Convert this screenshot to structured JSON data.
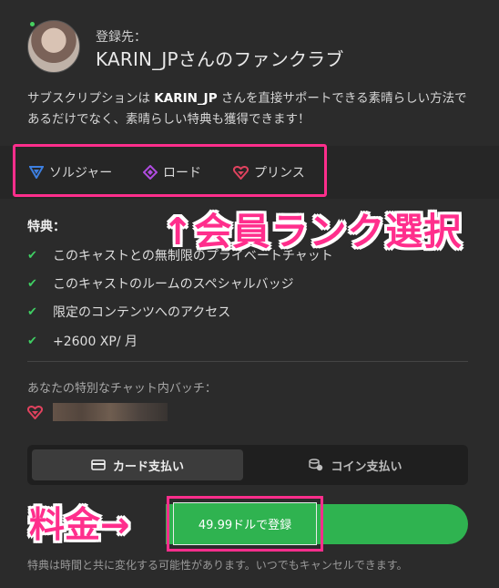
{
  "header": {
    "register_label": "登録先：",
    "club_name": "KARIN_JPさんのファンクラブ"
  },
  "description": {
    "part1": "サブスクリプションは ",
    "name": "KARIN_JP",
    "part2": " さんを直接サポートできる素晴らしい方法であるだけでなく、素晴らしい特典も獲得できます！"
  },
  "tabs": [
    {
      "label": "ソルジャー",
      "icon": "soldier-shield-icon",
      "color": "#3d7fe0"
    },
    {
      "label": "ロード",
      "icon": "lord-diamond-icon",
      "color": "#b04be0"
    },
    {
      "label": "プリンス",
      "icon": "prince-heart-icon",
      "color": "#e0425e",
      "selected": true
    }
  ],
  "annotations": {
    "rank": "↑会員ランク選択",
    "price": "料金→"
  },
  "benefits": {
    "title": "特典：",
    "items": [
      "このキャストとの無制限のプライベートチャット",
      "このキャストのルームのスペシャルバッジ",
      "限定のコンテンツへのアクセス",
      "+2600 XP/ 月"
    ]
  },
  "badge": {
    "label": "あなたの特別なチャット内バッチ："
  },
  "payment": {
    "card_label": "カード支払い",
    "coin_label": "コイン支払い",
    "selected": "card"
  },
  "submit": {
    "label": "49.99ドルで登録"
  },
  "note": "特典は時間と共に変化する可能性があります。いつでもキャンセルできます。",
  "colors": {
    "background": "#2b2b2b",
    "accent_green": "#2fb350",
    "annotation_pink": "#ff2e8c",
    "check_green": "#3fcf63"
  }
}
